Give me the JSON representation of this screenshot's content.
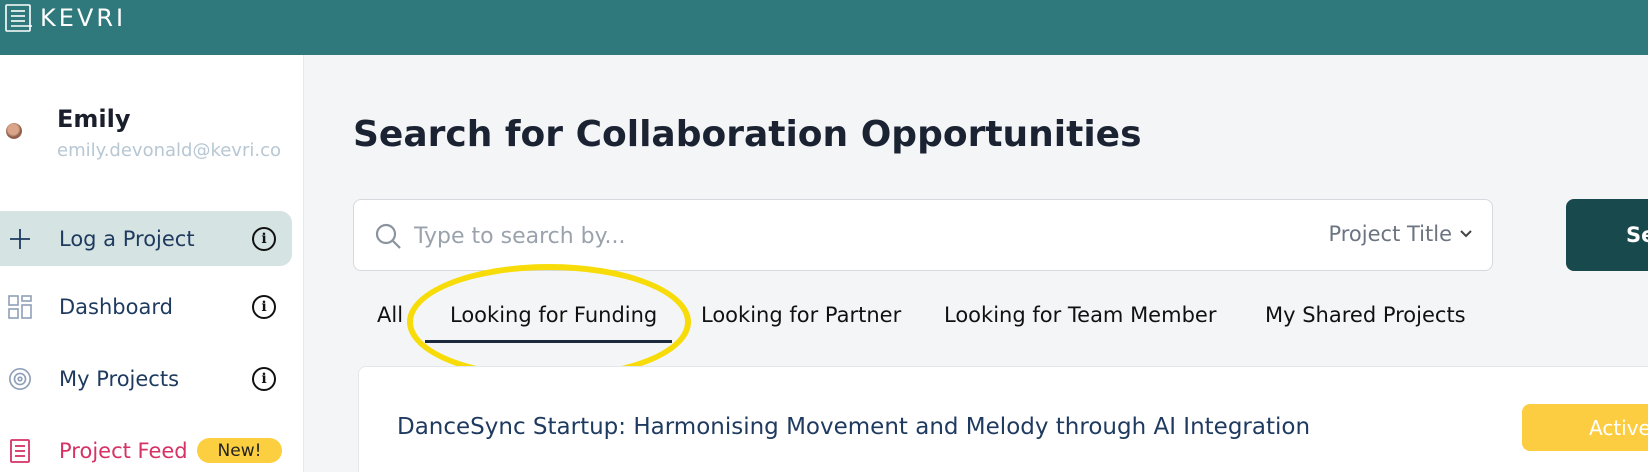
{
  "app": {
    "brand": "KEVRI"
  },
  "user": {
    "name": "Emily",
    "email": "emily.devonald@kevri.co"
  },
  "sidebar": {
    "items": [
      {
        "label": "Log a Project",
        "icon": "plus-icon",
        "info": "i"
      },
      {
        "label": "Dashboard",
        "icon": "grid-icon",
        "info": "i"
      },
      {
        "label": "My Projects",
        "icon": "target-icon",
        "info": "i"
      },
      {
        "label": "Project Feed",
        "icon": "document-icon",
        "badge": "New!"
      }
    ]
  },
  "main": {
    "title": "Search for Collaboration Opportunities",
    "search": {
      "placeholder": "Type to search by...",
      "scope": "Project Title",
      "button": "Se"
    },
    "tabs": [
      {
        "label": "All"
      },
      {
        "label": "Looking for Funding",
        "selected": true
      },
      {
        "label": "Looking for Partner"
      },
      {
        "label": "Looking for Team Member"
      },
      {
        "label": "My Shared Projects"
      }
    ],
    "project": {
      "title": "DanceSync Startup: Harmonising Movement and Melody through AI Integration",
      "status": "Active"
    }
  },
  "colors": {
    "topbar": "#2f787c",
    "active_nav_bg": "#d5e3e2",
    "search_button": "#17494d",
    "badge_yellow": "#fbcf3f",
    "highlight": "#f7dc09",
    "project_feed_accent": "#d63265"
  }
}
